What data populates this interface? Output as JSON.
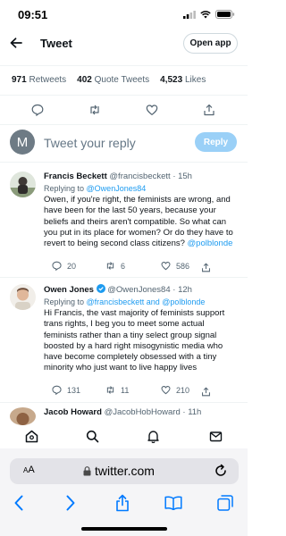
{
  "status_bar": {
    "time": "09:51"
  },
  "header": {
    "title": "Tweet",
    "open_app_label": "Open app"
  },
  "stats": [
    {
      "count": "971",
      "label": "Retweets"
    },
    {
      "count": "402",
      "label": "Quote Tweets"
    },
    {
      "count": "4,523",
      "label": "Likes"
    }
  ],
  "reply_box": {
    "avatar_letter": "M",
    "placeholder": "Tweet your reply",
    "button_label": "Reply"
  },
  "replies": [
    {
      "name": "Francis Beckett",
      "handle": "@francisbeckett",
      "time": "· 15h",
      "replying_prefix": "Replying to",
      "replying_to": "@OwenJones84",
      "text": "Owen, if you're right, the feminists are wrong, and have been for the last 50 years, because your beliefs and theirs aren't compatible. So what can you put in its place for women?  Or do they have to revert to being second class citizens?",
      "text_mention": "@polblonde",
      "replies": "20",
      "retweets": "6",
      "likes": "586"
    },
    {
      "name": "Owen Jones",
      "handle": "@OwenJones84",
      "time": "· 12h",
      "replying_prefix": "Replying to",
      "replying_to": "@francisbeckett and @polblonde",
      "text": "Hi Francis, the vast majority of feminists support trans rights, I beg you to meet some actual feminists rather than a tiny select group signal boosted by a hard right misogynistic media who have become completely obsessed with a tiny minority who just want to live happy lives",
      "replies": "131",
      "retweets": "11",
      "likes": "210"
    },
    {
      "name": "Jacob Howard",
      "handle": "@JacobHobHoward",
      "time": "· 11h"
    }
  ],
  "safari": {
    "aa_small": "A",
    "aa_large": "A",
    "domain": "twitter.com"
  },
  "colors": {
    "link_blue": "#1d9bf0",
    "safari_blue": "#007aff",
    "reply_button": "#9ad0f7"
  },
  "icons": {
    "tabs": [
      "home-icon",
      "search-icon",
      "notifications-bell-icon",
      "messages-mail-icon"
    ],
    "safari_nav": [
      "back-chevron-icon",
      "forward-chevron-icon",
      "share-icon",
      "bookmarks-book-icon",
      "tabs-icon"
    ]
  }
}
